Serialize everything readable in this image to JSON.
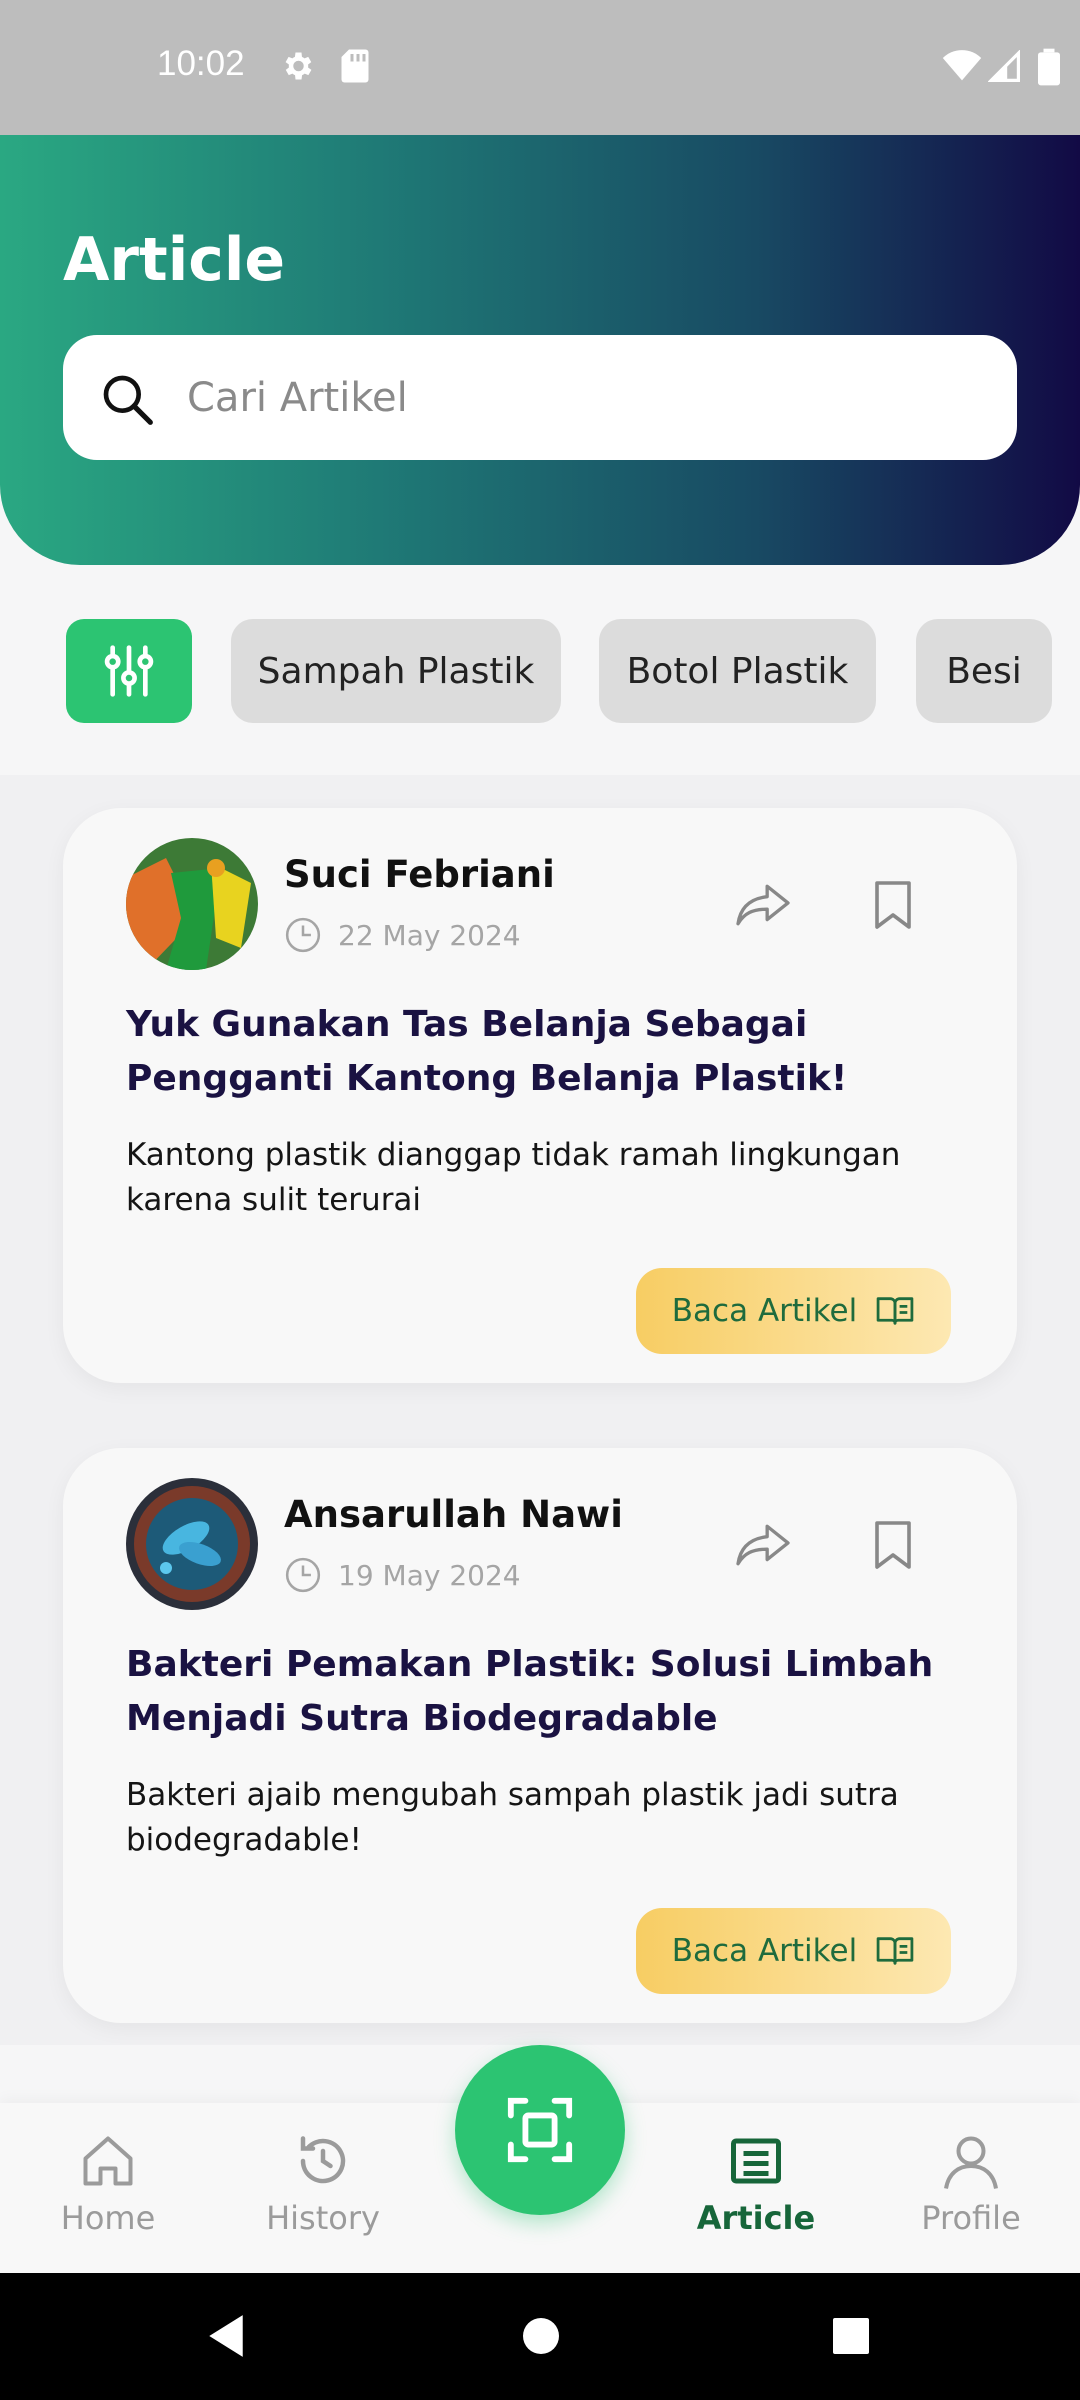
{
  "status_bar": {
    "time": "10:02"
  },
  "header": {
    "title": "Article",
    "search_placeholder": "Cari Artikel"
  },
  "filters": {
    "chips": [
      "Sampah Plastik",
      "Botol Plastik",
      "Besi"
    ]
  },
  "articles": [
    {
      "author": "Suci Febriani",
      "date": "22 May 2024",
      "title": "Yuk Gunakan Tas Belanja Sebagai Pengganti Kantong Belanja Plastik!",
      "description": "Kantong plastik dianggap tidak ramah lingkungan karena sulit terurai",
      "button_label": "Baca Artikel"
    },
    {
      "author": "Ansarullah Nawi",
      "date": "19 May 2024",
      "title": "Bakteri Pemakan Plastik: Solusi Limbah Menjadi Sutra Biodegradable",
      "description": "Bakteri ajaib mengubah sampah plastik jadi sutra biodegradable!",
      "button_label": "Baca Artikel"
    }
  ],
  "bottom_nav": {
    "items": [
      {
        "label": "Home",
        "icon": "home-icon"
      },
      {
        "label": "History",
        "icon": "history-icon"
      },
      {
        "label": "Article",
        "icon": "article-icon",
        "active": true
      },
      {
        "label": "Profile",
        "icon": "profile-icon"
      }
    ],
    "center_icon": "scan-icon"
  },
  "colors": {
    "accent_green": "#2cc472",
    "active_nav": "#17663a",
    "title_navy": "#1a1242",
    "button_yellow": "#f7cd63"
  }
}
